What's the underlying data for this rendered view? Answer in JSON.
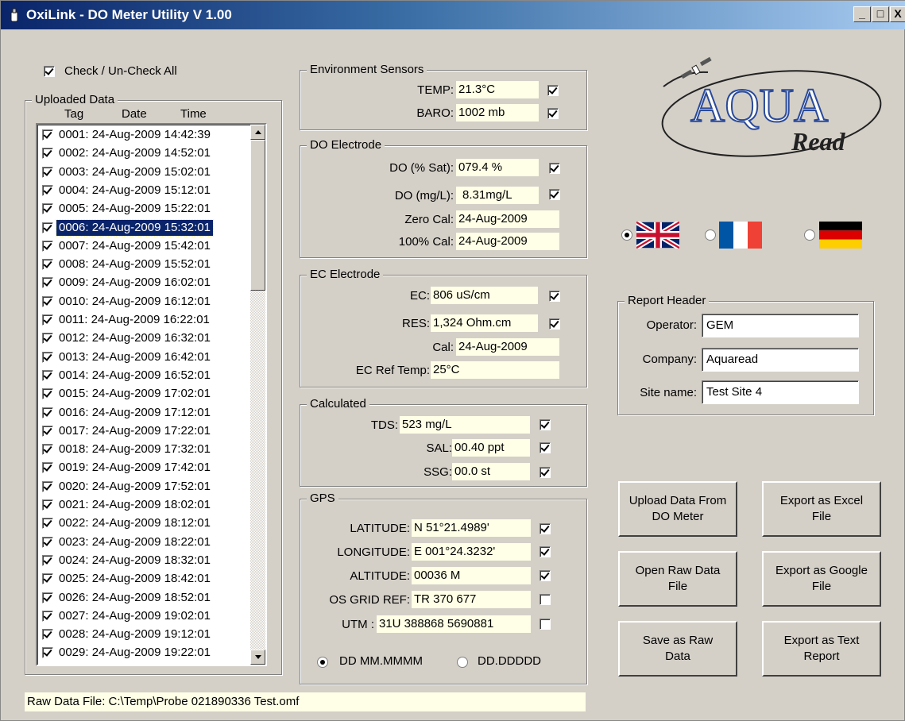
{
  "window": {
    "title": "OxiLink - DO Meter Utility V 1.00",
    "minimize": "_",
    "maximize": "□",
    "close": "X"
  },
  "check_all": {
    "label": "Check / Un-Check All",
    "checked": true
  },
  "uploaded": {
    "caption": "Uploaded Data",
    "col_tag": "Tag",
    "col_date": "Date",
    "col_time": "Time",
    "rows": [
      "0001: 24-Aug-2009 14:42:39",
      "0002: 24-Aug-2009 14:52:01",
      "0003: 24-Aug-2009 15:02:01",
      "0004: 24-Aug-2009 15:12:01",
      "0005: 24-Aug-2009 15:22:01",
      "0006: 24-Aug-2009 15:32:01",
      "0007: 24-Aug-2009 15:42:01",
      "0008: 24-Aug-2009 15:52:01",
      "0009: 24-Aug-2009 16:02:01",
      "0010: 24-Aug-2009 16:12:01",
      "0011: 24-Aug-2009 16:22:01",
      "0012: 24-Aug-2009 16:32:01",
      "0013: 24-Aug-2009 16:42:01",
      "0014: 24-Aug-2009 16:52:01",
      "0015: 24-Aug-2009 17:02:01",
      "0016: 24-Aug-2009 17:12:01",
      "0017: 24-Aug-2009 17:22:01",
      "0018: 24-Aug-2009 17:32:01",
      "0019: 24-Aug-2009 17:42:01",
      "0020: 24-Aug-2009 17:52:01",
      "0021: 24-Aug-2009 18:02:01",
      "0022: 24-Aug-2009 18:12:01",
      "0023: 24-Aug-2009 18:22:01",
      "0024: 24-Aug-2009 18:32:01",
      "0025: 24-Aug-2009 18:42:01",
      "0026: 24-Aug-2009 18:52:01",
      "0027: 24-Aug-2009 19:02:01",
      "0028: 24-Aug-2009 19:12:01",
      "0029: 24-Aug-2009 19:22:01"
    ],
    "selected_index": 5
  },
  "env": {
    "caption": "Environment Sensors",
    "temp_label": "TEMP:",
    "temp_value": "21.3°C",
    "baro_label": "BARO:",
    "baro_value": "1002 mb"
  },
  "do": {
    "caption": "DO Electrode",
    "sat_label": "DO (% Sat):",
    "sat_value": "079.4 %",
    "mgl_label": "DO (mg/L):",
    "mgl_value": "8.31mg/L",
    "zero_label": "Zero Cal:",
    "zero_value": "24-Aug-2009",
    "full_label": "100% Cal:",
    "full_value": "24-Aug-2009"
  },
  "ec": {
    "caption": "EC Electrode",
    "ec_label": "EC:",
    "ec_value": "806 uS/cm",
    "res_label": "RES:",
    "res_value": "1,324 Ohm.cm",
    "cal_label": "Cal:",
    "cal_value": "24-Aug-2009",
    "ref_label": "EC Ref Temp:",
    "ref_value": "25°C"
  },
  "calc": {
    "caption": "Calculated",
    "tds_label": "TDS:",
    "tds_value": "523 mg/L",
    "sal_label": "SAL:",
    "sal_value": "00.40 ppt",
    "ssg_label": "SSG:",
    "ssg_value": "00.0 st"
  },
  "gps": {
    "caption": "GPS",
    "lat_label": "LATITUDE:",
    "lat_value": "N 51°21.4989'",
    "lon_label": "LONGITUDE:",
    "lon_value": "E 001°24.3232'",
    "alt_label": "ALTITUDE:",
    "alt_value": "00036 M",
    "os_label": "OS GRID REF:",
    "os_value": "TR 370 677",
    "utm_label": "UTM :",
    "utm_value": "31U 388868 5690881",
    "fmt_ddmm": "DD MM.MMMM",
    "fmt_dd": "DD.DDDDD"
  },
  "logo": {
    "main": "AQUA",
    "sub": "Read"
  },
  "languages": {
    "selected": "english",
    "items": [
      "english",
      "french",
      "german"
    ]
  },
  "report": {
    "caption": "Report Header",
    "operator_label": "Operator:",
    "operator_value": "GEM",
    "company_label": "Company:",
    "company_value": "Aquaread",
    "site_label": "Site name:",
    "site_value": "Test Site 4"
  },
  "buttons": {
    "upload": "Upload Data From\nDO Meter",
    "excel": "Export as Excel\nFile",
    "open_raw": "Open Raw Data\nFile",
    "google": "Export as Google\nFile",
    "save_raw": "Save as Raw\nData",
    "text": "Export as Text\nReport"
  },
  "footer": {
    "raw_file": "Raw Data File: C:\\Temp\\Probe 021890336 Test.omf"
  },
  "colors": {
    "title_start": "#0a246a",
    "face": "#d4d0c8",
    "value_bg": "#ffffe7",
    "logo_blue": "#2a4a9a"
  }
}
